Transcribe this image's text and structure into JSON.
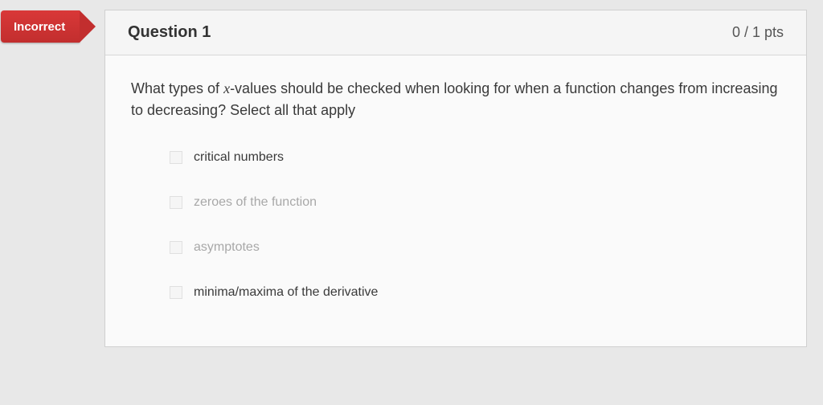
{
  "badge": {
    "label": "Incorrect"
  },
  "header": {
    "title": "Question 1",
    "points": "0 / 1 pts"
  },
  "body": {
    "prompt_before": "What types of ",
    "prompt_var": "x",
    "prompt_after": "-values should be checked when looking for when a function changes from increasing to decreasing? Select all that apply"
  },
  "answers": [
    {
      "label": "critical numbers",
      "muted": false
    },
    {
      "label": "zeroes of the function",
      "muted": true
    },
    {
      "label": "asymptotes",
      "muted": true
    },
    {
      "label": "minima/maxima of the derivative",
      "muted": false
    }
  ]
}
